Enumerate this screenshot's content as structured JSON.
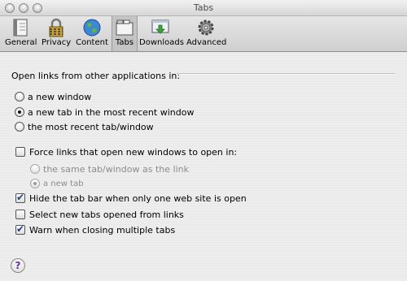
{
  "window": {
    "title": "Tabs"
  },
  "toolbar": {
    "items": [
      {
        "label": "General",
        "icon": "general-icon"
      },
      {
        "label": "Privacy",
        "icon": "privacy-icon"
      },
      {
        "label": "Content",
        "icon": "content-icon"
      },
      {
        "label": "Tabs",
        "icon": "tabs-icon",
        "selected": true
      },
      {
        "label": "Downloads",
        "icon": "downloads-icon"
      },
      {
        "label": "Advanced",
        "icon": "advanced-icon"
      }
    ]
  },
  "open_links": {
    "label": "Open links from other applications in:",
    "options": [
      {
        "label": "a new window",
        "selected": false
      },
      {
        "label": "a new tab in the most recent window",
        "selected": true
      },
      {
        "label": "the most recent tab/window",
        "selected": false
      }
    ]
  },
  "force_links": {
    "label": "Force links that open new windows to open in:",
    "checked": false,
    "options": [
      {
        "label": "the same tab/window as the link",
        "selected": false
      },
      {
        "label": "a new tab",
        "selected": true
      }
    ]
  },
  "hide_tab_bar": {
    "label": "Hide the tab bar when only one web site is open",
    "checked": true
  },
  "select_new_tabs": {
    "label": "Select new tabs opened from links",
    "checked": false
  },
  "warn_closing": {
    "label": "Warn when closing multiple tabs",
    "checked": true
  },
  "help": {
    "label": "?"
  },
  "colors": {
    "window_bg": "#ededed",
    "check_mark": "#1b3f8a",
    "help_mark": "#5b2fa6"
  }
}
